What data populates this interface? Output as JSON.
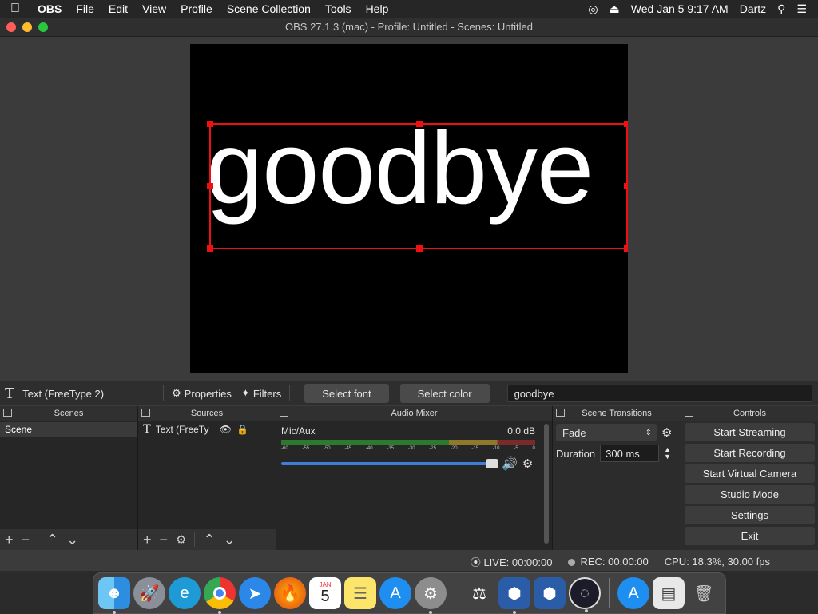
{
  "menubar": {
    "app": "OBS",
    "items": [
      "File",
      "Edit",
      "View",
      "Profile",
      "Scene Collection",
      "Tools",
      "Help"
    ],
    "clock": "Wed Jan 5  9:17 AM",
    "user": "Dartz"
  },
  "window": {
    "title": "OBS 27.1.3 (mac) - Profile: Untitled - Scenes: Untitled"
  },
  "preview": {
    "text": "goodbye"
  },
  "source_toolbar": {
    "source_name": "Text (FreeType 2)",
    "properties": "Properties",
    "filters": "Filters",
    "select_font": "Select font",
    "select_color": "Select color",
    "text_value": "goodbye"
  },
  "docks": {
    "scenes": {
      "title": "Scenes",
      "items": [
        "Scene"
      ]
    },
    "sources": {
      "title": "Sources",
      "items": [
        "Text (FreeTy"
      ]
    },
    "mixer": {
      "title": "Audio Mixer",
      "channel": "Mic/Aux",
      "level": "0.0 dB",
      "ticks": [
        "-60",
        "-55",
        "-50",
        "-45",
        "-40",
        "-35",
        "-30",
        "-25",
        "-20",
        "-15",
        "-10",
        "-5",
        "0"
      ]
    },
    "transitions": {
      "title": "Scene Transitions",
      "type": "Fade",
      "duration_label": "Duration",
      "duration_value": "300 ms"
    },
    "controls": {
      "title": "Controls",
      "buttons": [
        "Start Streaming",
        "Start Recording",
        "Start Virtual Camera",
        "Studio Mode",
        "Settings",
        "Exit"
      ]
    }
  },
  "status": {
    "live": "LIVE: 00:00:00",
    "rec": "REC: 00:00:00",
    "cpu": "CPU: 18.3%, 30.00 fps"
  },
  "dock_calendar": {
    "month": "JAN",
    "day": "5"
  }
}
